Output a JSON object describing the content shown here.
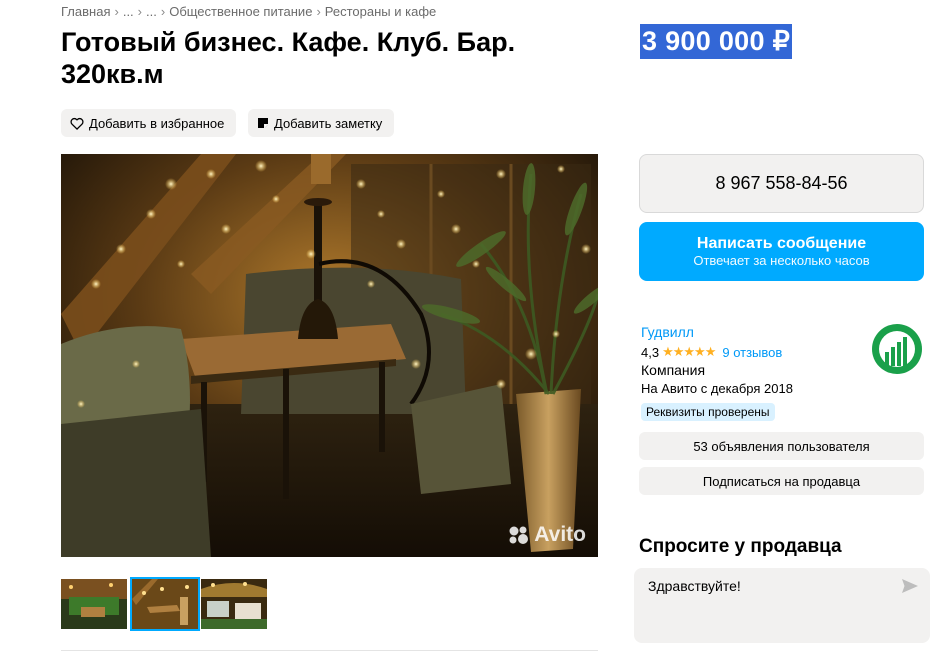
{
  "breadcrumbs": [
    "Главная",
    "...",
    "...",
    "Общественное питание",
    "Рестораны и кафе"
  ],
  "title": "Готовый бизнес. Кафе. Клуб. Бар. 320кв.м",
  "price": "3 900 000 ₽",
  "actions": {
    "favorite_label": "Добавить в избранное",
    "note_label": "Добавить заметку"
  },
  "gallery": {
    "watermark": "Avito",
    "thumbnails_count": 3,
    "active_thumbnail": 2
  },
  "contact": {
    "phone": "8 967 558-84-56",
    "message_title": "Написать сообщение",
    "message_subtitle": "Отвечает за несколько часов"
  },
  "seller": {
    "name": "Гудвилл",
    "rating": "4,3",
    "rating_value": 4.3,
    "reviews": "9 отзывов",
    "type": "Компания",
    "since": "На Авито с декабря 2018",
    "verified_badge": "Реквизиты проверены",
    "listings_button": "53 объявления пользователя",
    "subscribe_button": "Подписаться на продавца"
  },
  "ask": {
    "title": "Спросите у продавца",
    "message": "Здравствуйте!"
  },
  "colors": {
    "accent": "#00aaff",
    "link": "#0099f7",
    "price_highlight": "#3367d6",
    "star": "#ffb021",
    "seller_logo": "#1aa04a"
  },
  "icons": [
    "heart-icon",
    "note-icon",
    "star-icon",
    "send-icon",
    "avito-logo-icon"
  ]
}
